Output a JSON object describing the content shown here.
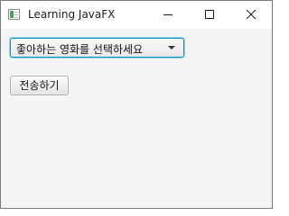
{
  "window": {
    "title": "Learning JavaFX",
    "app_icon": "javafx-window-icon",
    "controls": {
      "minimize_icon": "minimize-icon",
      "maximize_icon": "maximize-icon",
      "close_icon": "close-icon"
    }
  },
  "combo": {
    "prompt": "좋아하는 영화를 선택하세요",
    "arrow_icon": "chevron-down-icon",
    "focus_color": "#0096c9"
  },
  "submit": {
    "label": "전송하기"
  }
}
